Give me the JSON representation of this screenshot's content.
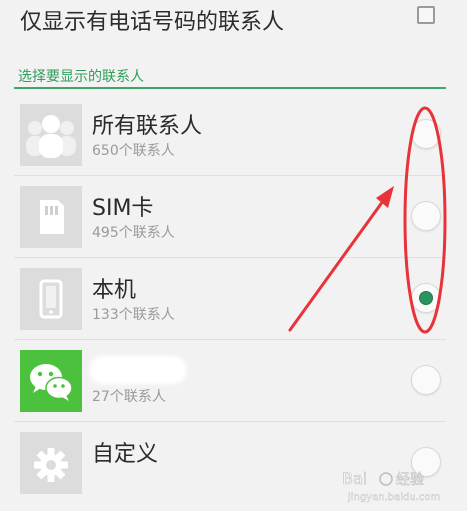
{
  "top_option": {
    "label": "仅显示有电话号码的联系人",
    "checked": false
  },
  "section_header": "选择要显示的联系人",
  "accent_color": "#3da769",
  "annotation_color": "#e8333b",
  "contacts": [
    {
      "name": "所有联系人",
      "count": "650个联系人",
      "icon": "group-people-icon",
      "selected": false
    },
    {
      "name": "SIM卡",
      "count": "495个联系人",
      "icon": "sim-card-icon",
      "selected": false
    },
    {
      "name": "本机",
      "count": "133个联系人",
      "icon": "phone-device-icon",
      "selected": true
    },
    {
      "name": "",
      "count": "27个联系人",
      "icon": "wechat-icon",
      "selected": false
    },
    {
      "name": "自定义",
      "count": "",
      "icon": "settings-gear-icon",
      "selected": false
    }
  ]
}
